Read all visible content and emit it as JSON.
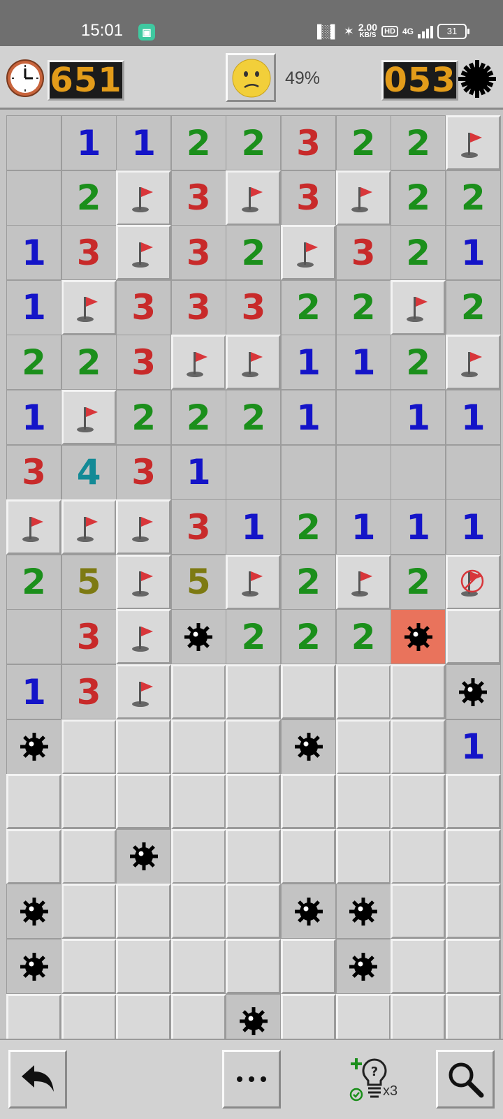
{
  "status_bar": {
    "time": "15:01",
    "net_speed": "2.00",
    "net_speed_unit": "KB/S",
    "hd_label": "HD",
    "network": "4G",
    "battery": "31"
  },
  "game_header": {
    "timer": "651",
    "progress": "49%",
    "mines_remaining": "053",
    "face": "confused-face"
  },
  "board": {
    "columns": 9,
    "legend": "cell codes: '' open blank, '1'-'5' number, 'F' flag, 'X' wrong flag, 'M' mine, 'B' exploded mine, '#' closed",
    "rows": [
      [
        "",
        "1",
        "1",
        "2",
        "2",
        "3",
        "2",
        "2",
        "F"
      ],
      [
        "",
        "2",
        "F",
        "3",
        "F",
        "3",
        "F",
        "2",
        "2"
      ],
      [
        "1",
        "3",
        "F",
        "3",
        "2",
        "F",
        "3",
        "2",
        "1"
      ],
      [
        "1",
        "F",
        "3",
        "3",
        "3",
        "2",
        "2",
        "F",
        "2"
      ],
      [
        "2",
        "2",
        "3",
        "F",
        "F",
        "1",
        "1",
        "2",
        "F"
      ],
      [
        "1",
        "F",
        "2",
        "2",
        "2",
        "1",
        "",
        "1",
        "1"
      ],
      [
        "3",
        "4",
        "3",
        "1",
        "",
        "",
        "",
        "",
        ""
      ],
      [
        "F",
        "F",
        "F",
        "3",
        "1",
        "2",
        "1",
        "1",
        "1"
      ],
      [
        "2",
        "5",
        "F",
        "5",
        "F",
        "2",
        "F",
        "2",
        "X"
      ],
      [
        "",
        "3",
        "F",
        "M",
        "2",
        "2",
        "2",
        "B",
        "#"
      ],
      [
        "1",
        "3",
        "F",
        "#",
        "#",
        "#",
        "#",
        "#",
        "M"
      ],
      [
        "M",
        "#",
        "#",
        "#",
        "#",
        "M",
        "#",
        "#",
        "1"
      ],
      [
        "#",
        "#",
        "#",
        "#",
        "#",
        "#",
        "#",
        "#",
        "#"
      ],
      [
        "#",
        "#",
        "M",
        "#",
        "#",
        "#",
        "#",
        "#",
        "#"
      ],
      [
        "M",
        "#",
        "#",
        "#",
        "#",
        "M",
        "M",
        "#",
        "#"
      ],
      [
        "M",
        "#",
        "#",
        "#",
        "#",
        "#",
        "M",
        "#",
        "#"
      ],
      [
        "#",
        "#",
        "#",
        "#",
        "M",
        "#",
        "#",
        "#",
        "#"
      ]
    ]
  },
  "toolbar": {
    "undo": "undo-icon",
    "more": "more-icon",
    "hint_count": "x3",
    "zoom": "magnifier-icon"
  },
  "colors": {
    "n1": "#1414c8",
    "n2": "#1b8f1b",
    "n3": "#c82a2a",
    "n4": "#138a96",
    "n5": "#7d7a12",
    "exploded": "#e9735c",
    "lcd_digits": "#e39c1a"
  }
}
